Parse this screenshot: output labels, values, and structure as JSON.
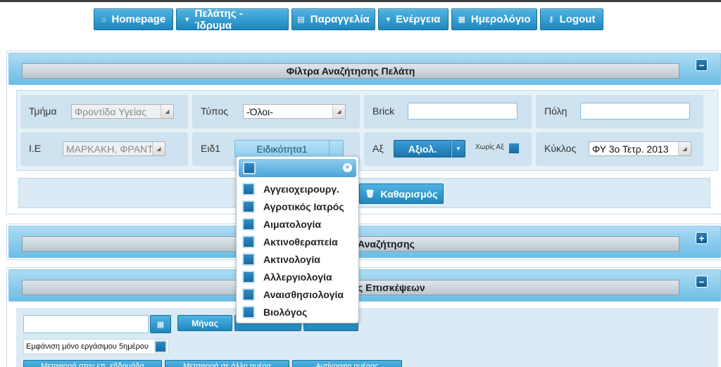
{
  "nav": {
    "items": [
      {
        "label": "Homepage",
        "icon": "home-icon",
        "glyph": "⌂"
      },
      {
        "label": "Πελάτης - Ίδρυμα",
        "icon": "caret-down-icon",
        "glyph": "▾"
      },
      {
        "label": "Παραγγελία",
        "icon": "database-icon",
        "glyph": "▤"
      },
      {
        "label": "Ενέργεια",
        "icon": "caret-down-icon",
        "glyph": "▾"
      },
      {
        "label": "Ημερολόγιο",
        "icon": "calendar-icon",
        "glyph": "▦"
      },
      {
        "label": "Logout",
        "icon": "key-icon",
        "glyph": "⚷"
      }
    ]
  },
  "panel1": {
    "title": "Φίλτρα Αναζήτησης Πελάτη",
    "toggle": "−",
    "fields": {
      "tmima": {
        "label": "Τμήμα",
        "value": "Φροντίδα Υγείας"
      },
      "typos": {
        "label": "Τύπος",
        "value": "-Όλοι-"
      },
      "brick": {
        "label": "Brick",
        "value": ""
      },
      "poli": {
        "label": "Πόλη",
        "value": ""
      },
      "ie": {
        "label": "Ι.Ε",
        "value": "ΜΑΡΚΑΚΗ, ΦΡΑΝΤΖ"
      },
      "eid1": {
        "label": "Ειδ1",
        "value": "Ειδικότητα1"
      },
      "ax": {
        "label": "Αξ",
        "value": "Αξιολ.",
        "no_ax_label": "Χωρίς Αξ"
      },
      "kyklos": {
        "label": "Κύκλος",
        "value": "ΦΥ 3ο Τετρ. 2013"
      }
    },
    "clear_label": "Καθαρισμός"
  },
  "panel2": {
    "title_visible": "Αναζήτησης",
    "toggle": "+"
  },
  "panel3": {
    "title_visible": "ς Επισκέψεων",
    "toggle": "−",
    "date_value": "",
    "time_buttons": [
      "Μήνας",
      "",
      ""
    ],
    "weekdays_label": "Εμφάνιση μόνο εργάσιμου 5ημέρου",
    "bottom_buttons": [
      "Μεταφορά στην επ. εβδομάδα",
      "Μεταφορά σε άλλη ημέρα",
      "Αντίγραφο ημέρας"
    ]
  },
  "dropdown": {
    "close": "×",
    "items": [
      "Αγγειοχειρουργ.",
      "Αγροτικός Ιατρός",
      "Αιματολογία",
      "Ακτινοθεραπεία",
      "Ακτινολογία",
      "Αλλεργιολογία",
      "Αναισθησιολογία",
      "Βιολόγος"
    ]
  },
  "colors": {
    "accent": "#1f87bd",
    "header": "#6bbde6"
  }
}
